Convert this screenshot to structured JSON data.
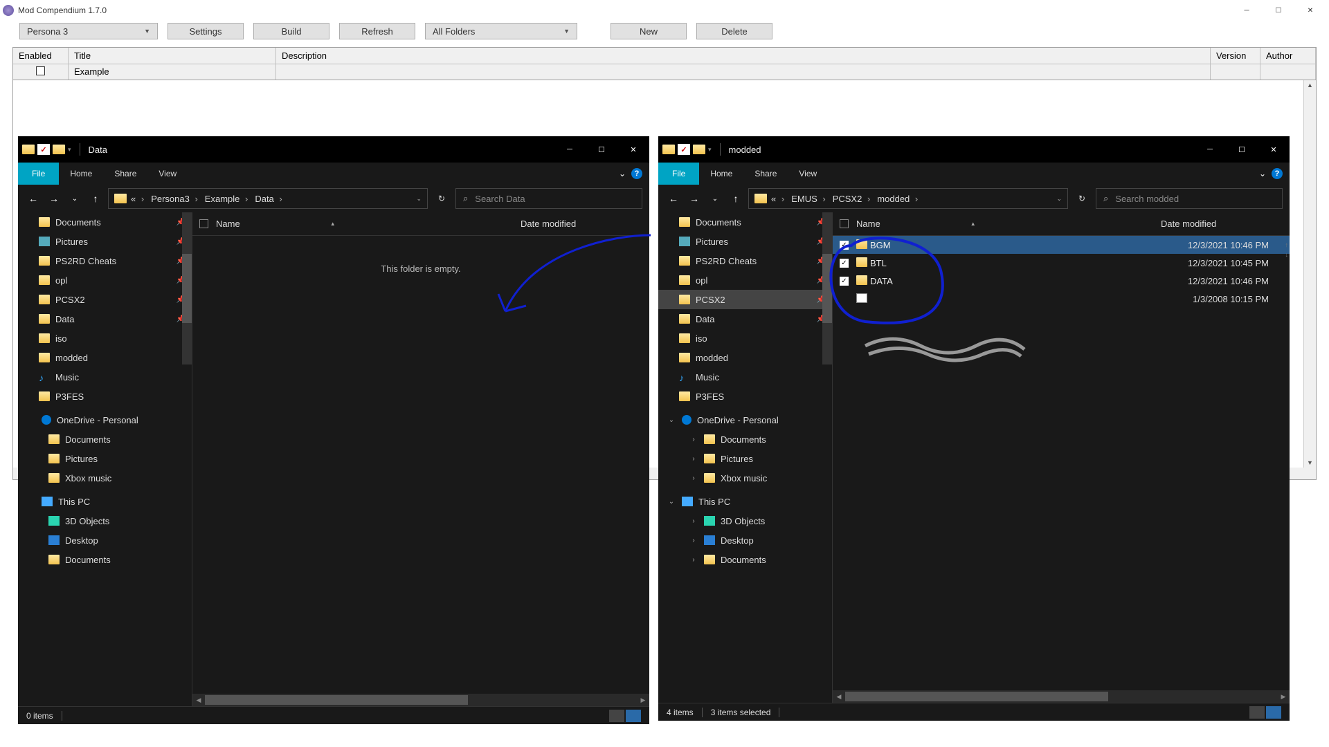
{
  "mc": {
    "title": "Mod Compendium 1.7.0",
    "game_dropdown": "Persona 3",
    "folder_dropdown": "All Folders",
    "buttons": {
      "settings": "Settings",
      "build": "Build",
      "refresh": "Refresh",
      "new": "New",
      "delete": "Delete"
    },
    "columns": {
      "enabled": "Enabled",
      "title": "Title",
      "description": "Description",
      "version": "Version",
      "author": "Author"
    },
    "row1": {
      "title": "Example"
    }
  },
  "ex1": {
    "title": "Data",
    "tabs": {
      "file": "File",
      "home": "Home",
      "share": "Share",
      "view": "View"
    },
    "breadcrumbs": [
      "«",
      "Persona3",
      "Example",
      "Data"
    ],
    "search_placeholder": "Search Data",
    "columns": {
      "name": "Name",
      "date": "Date modified"
    },
    "empty": "This folder is empty.",
    "status": "0 items",
    "sidebar": {
      "quick": [
        {
          "label": "Documents",
          "icon": "fld",
          "pin": true
        },
        {
          "label": "Pictures",
          "icon": "pic",
          "pin": true
        },
        {
          "label": "PS2RD Cheats",
          "icon": "fld",
          "pin": true
        },
        {
          "label": "opl",
          "icon": "fld",
          "pin": true
        },
        {
          "label": "PCSX2",
          "icon": "fld",
          "pin": true
        },
        {
          "label": "Data",
          "icon": "fld",
          "pin": true
        },
        {
          "label": "iso",
          "icon": "fld",
          "pin": false
        },
        {
          "label": "modded",
          "icon": "fld",
          "pin": false
        },
        {
          "label": "Music",
          "icon": "mus",
          "pin": false
        },
        {
          "label": "P3FES",
          "icon": "fld",
          "pin": false
        }
      ],
      "onedrive_label": "OneDrive - Personal",
      "onedrive": [
        {
          "label": "Documents",
          "icon": "fld"
        },
        {
          "label": "Pictures",
          "icon": "fld"
        },
        {
          "label": "Xbox music",
          "icon": "fld"
        }
      ],
      "thispc_label": "This PC",
      "thispc": [
        {
          "label": "3D Objects",
          "icon": "d3"
        },
        {
          "label": "Desktop",
          "icon": "desk"
        },
        {
          "label": "Documents",
          "icon": "fld"
        }
      ]
    }
  },
  "ex2": {
    "title": "modded",
    "tabs": {
      "file": "File",
      "home": "Home",
      "share": "Share",
      "view": "View"
    },
    "breadcrumbs": [
      "«",
      "EMUS",
      "PCSX2",
      "modded"
    ],
    "search_placeholder": "Search modded",
    "columns": {
      "name": "Name",
      "date": "Date modified"
    },
    "status_items": "4 items",
    "status_selected": "3 items selected",
    "rows": [
      {
        "name": "BGM",
        "date": "12/3/2021 10:46 PM",
        "checked": true,
        "sel": true
      },
      {
        "name": "BTL",
        "date": "12/3/2021 10:45 PM",
        "checked": true,
        "sel": false
      },
      {
        "name": "DATA",
        "date": "12/3/2021 10:46 PM",
        "checked": true,
        "sel": false
      },
      {
        "name": "",
        "date": "1/3/2008 10:15 PM",
        "checked": false,
        "sel": false
      }
    ],
    "sidebar": {
      "quick": [
        {
          "label": "Documents",
          "icon": "fld",
          "pin": true
        },
        {
          "label": "Pictures",
          "icon": "pic",
          "pin": true
        },
        {
          "label": "PS2RD Cheats",
          "icon": "fld",
          "pin": true
        },
        {
          "label": "opl",
          "icon": "fld",
          "pin": true
        },
        {
          "label": "PCSX2",
          "icon": "fld",
          "pin": true,
          "sel": true
        },
        {
          "label": "Data",
          "icon": "fld",
          "pin": true
        },
        {
          "label": "iso",
          "icon": "fld",
          "pin": false
        },
        {
          "label": "modded",
          "icon": "fld",
          "pin": false
        },
        {
          "label": "Music",
          "icon": "mus",
          "pin": false
        },
        {
          "label": "P3FES",
          "icon": "fld",
          "pin": false
        }
      ],
      "onedrive_label": "OneDrive - Personal",
      "onedrive": [
        {
          "label": "Documents",
          "icon": "fld"
        },
        {
          "label": "Pictures",
          "icon": "fld"
        },
        {
          "label": "Xbox music",
          "icon": "fld"
        }
      ],
      "thispc_label": "This PC",
      "thispc": [
        {
          "label": "3D Objects",
          "icon": "d3"
        },
        {
          "label": "Desktop",
          "icon": "desk"
        },
        {
          "label": "Documents",
          "icon": "fld"
        }
      ]
    }
  }
}
